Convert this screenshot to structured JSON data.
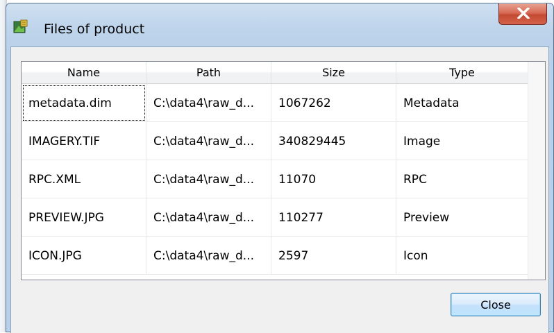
{
  "window": {
    "title": "Files of product",
    "app_icon": "product-app-icon",
    "close_icon": "close-icon"
  },
  "table": {
    "columns": [
      "Name",
      "Path",
      "Size",
      "Type"
    ],
    "rows": [
      {
        "name": "metadata.dim",
        "path": "C:\\data4\\raw_d...",
        "size": "1067262",
        "type": "Metadata"
      },
      {
        "name": "IMAGERY.TIF",
        "path": "C:\\data4\\raw_d...",
        "size": "340829445",
        "type": "Image"
      },
      {
        "name": "RPC.XML",
        "path": "C:\\data4\\raw_d...",
        "size": "11070",
        "type": "RPC"
      },
      {
        "name": "PREVIEW.JPG",
        "path": "C:\\data4\\raw_d...",
        "size": "110277",
        "type": "Preview"
      },
      {
        "name": "ICON.JPG",
        "path": "C:\\data4\\raw_d...",
        "size": "2597",
        "type": "Icon"
      }
    ]
  },
  "buttons": {
    "close_label": "Close"
  },
  "colors": {
    "titlebar": "#b9d1ea",
    "close_button_red": "#c44a32",
    "button_blue": "#3c7fb1"
  }
}
